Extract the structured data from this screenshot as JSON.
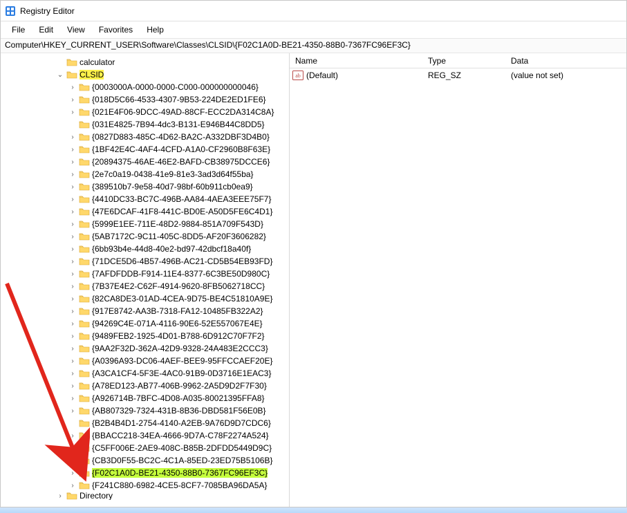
{
  "window": {
    "title": "Registry Editor"
  },
  "menu": {
    "file": "File",
    "edit": "Edit",
    "view": "View",
    "favorites": "Favorites",
    "help": "Help"
  },
  "addressbar": "Computer\\HKEY_CURRENT_USER\\Software\\Classes\\CLSID\\{F02C1A0D-BE21-4350-88B0-7367FC96EF3C}",
  "tree": {
    "calculator": "calculator",
    "clsid": "CLSID",
    "directory": "Directory",
    "keys": [
      "{0003000A-0000-0000-C000-000000000046}",
      "{018D5C66-4533-4307-9B53-224DE2ED1FE6}",
      "{021E4F06-9DCC-49AD-88CF-ECC2DA314C8A}",
      "{031E4825-7B94-4dc3-B131-E946B44C8DD5}",
      "{0827D883-485C-4D62-BA2C-A332DBF3D4B0}",
      "{1BF42E4C-4AF4-4CFD-A1A0-CF2960B8F63E}",
      "{20894375-46AE-46E2-BAFD-CB38975DCCE6}",
      "{2e7c0a19-0438-41e9-81e3-3ad3d64f55ba}",
      "{389510b7-9e58-40d7-98bf-60b911cb0ea9}",
      "{4410DC33-BC7C-496B-AA84-4AEA3EEE75F7}",
      "{47E6DCAF-41F8-441C-BD0E-A50D5FE6C4D1}",
      "{5999E1EE-711E-48D2-9884-851A709F543D}",
      "{5AB7172C-9C11-405C-8DD5-AF20F3606282}",
      "{6bb93b4e-44d8-40e2-bd97-42dbcf18a40f}",
      "{71DCE5D6-4B57-496B-AC21-CD5B54EB93FD}",
      "{7AFDFDDB-F914-11E4-8377-6C3BE50D980C}",
      "{7B37E4E2-C62F-4914-9620-8FB5062718CC}",
      "{82CA8DE3-01AD-4CEA-9D75-BE4C51810A9E}",
      "{917E8742-AA3B-7318-FA12-10485FB322A2}",
      "{94269C4E-071A-4116-90E6-52E557067E4E}",
      "{9489FEB2-1925-4D01-B788-6D912C70F7F2}",
      "{9AA2F32D-362A-42D9-9328-24A483E2CCC3}",
      "{A0396A93-DC06-4AEF-BEE9-95FFCCAEF20E}",
      "{A3CA1CF4-5F3E-4AC0-91B9-0D3716E1EAC3}",
      "{A78ED123-AB77-406B-9962-2A5D9D2F7F30}",
      "{A926714B-7BFC-4D08-A035-80021395FFA8}",
      "{AB807329-7324-431B-8B36-DBD581F56E0B}",
      "{B2B4B4D1-2754-4140-A2EB-9A76D9D7CDC6}",
      "{BBACC218-34EA-4666-9D7A-C78F2274A524}",
      "{C5FF006E-2AE9-408C-B85B-2DFDD5449D9C}",
      "{CB3D0F55-BC2C-4C1A-85ED-23ED75B5106B}",
      "{F02C1A0D-BE21-4350-88B0-7367FC96EF3C}",
      "{F241C880-6982-4CE5-8CF7-7085BA96DA5A}"
    ],
    "leaf_indices": [
      3,
      27
    ],
    "selected_index": 31
  },
  "values": {
    "header": {
      "name": "Name",
      "type": "Type",
      "data": "Data"
    },
    "rows": [
      {
        "name": "(Default)",
        "type": "REG_SZ",
        "data": "(value not set)"
      }
    ]
  }
}
